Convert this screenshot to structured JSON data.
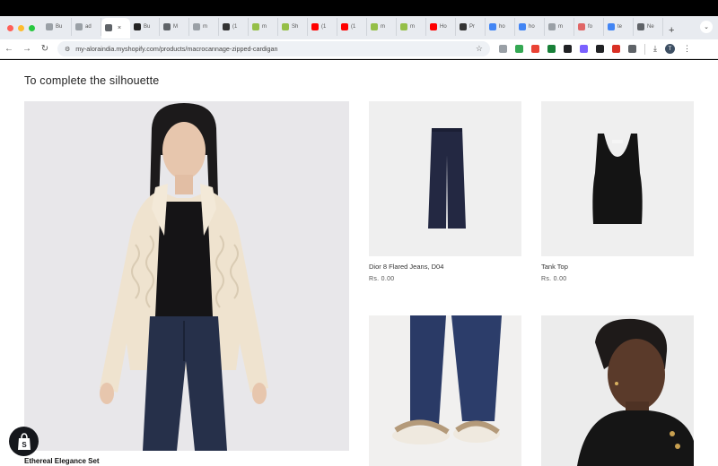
{
  "browser": {
    "tabs": [
      {
        "label": "Bu",
        "color": "#9aa0a6"
      },
      {
        "label": "ad",
        "color": "#9aa0a6"
      },
      {
        "label": "",
        "color": "#5f6368",
        "active": true
      },
      {
        "label": "Bu",
        "color": "#222222"
      },
      {
        "label": "M",
        "color": "#5f6368"
      },
      {
        "label": "m",
        "color": "#9aa0a6"
      },
      {
        "label": "(1",
        "color": "#333333"
      },
      {
        "label": "m",
        "color": "#95bf47"
      },
      {
        "label": "Sh",
        "color": "#95bf47"
      },
      {
        "label": "(1",
        "color": "#ff0000"
      },
      {
        "label": "(1",
        "color": "#ff0000"
      },
      {
        "label": "m",
        "color": "#95bf47"
      },
      {
        "label": "m",
        "color": "#95bf47"
      },
      {
        "label": "Ho",
        "color": "#ff0000"
      },
      {
        "label": "Pr",
        "color": "#333333"
      },
      {
        "label": "ho",
        "color": "#4285f4"
      },
      {
        "label": "ho",
        "color": "#4285f4"
      },
      {
        "label": "m",
        "color": "#9aa0a6"
      },
      {
        "label": "fo",
        "color": "#e06666"
      },
      {
        "label": "te",
        "color": "#4285f4"
      },
      {
        "label": "Ne",
        "color": "#5f6368"
      }
    ],
    "tab_close": "×",
    "new_tab": "+",
    "tab_menu": "⌄",
    "url": "my-aloraindia.myshopify.com/products/macrocannage-zipped-cardigan",
    "nav": {
      "back": "←",
      "forward": "→",
      "reload": "↻"
    },
    "star": "☆",
    "download": "⤓",
    "profile_initial": "T",
    "menu": "⋮",
    "extensions": [
      "#9aa0a6",
      "#34a853",
      "#ea4335",
      "#188038",
      "#202124",
      "#7b61ff",
      "#202124",
      "#d93025",
      "#5f6368"
    ]
  },
  "page": {
    "section_title": "To complete the silhouette",
    "hero": {
      "name": "Ethereal Elegance Set"
    },
    "products": [
      {
        "name": "Dior 8 Flared Jeans, D04",
        "price": "Rs. 0.00"
      },
      {
        "name": "Tank Top",
        "price": "Rs. 0.00"
      }
    ],
    "shopify_badge": "shopify-bag-icon"
  }
}
